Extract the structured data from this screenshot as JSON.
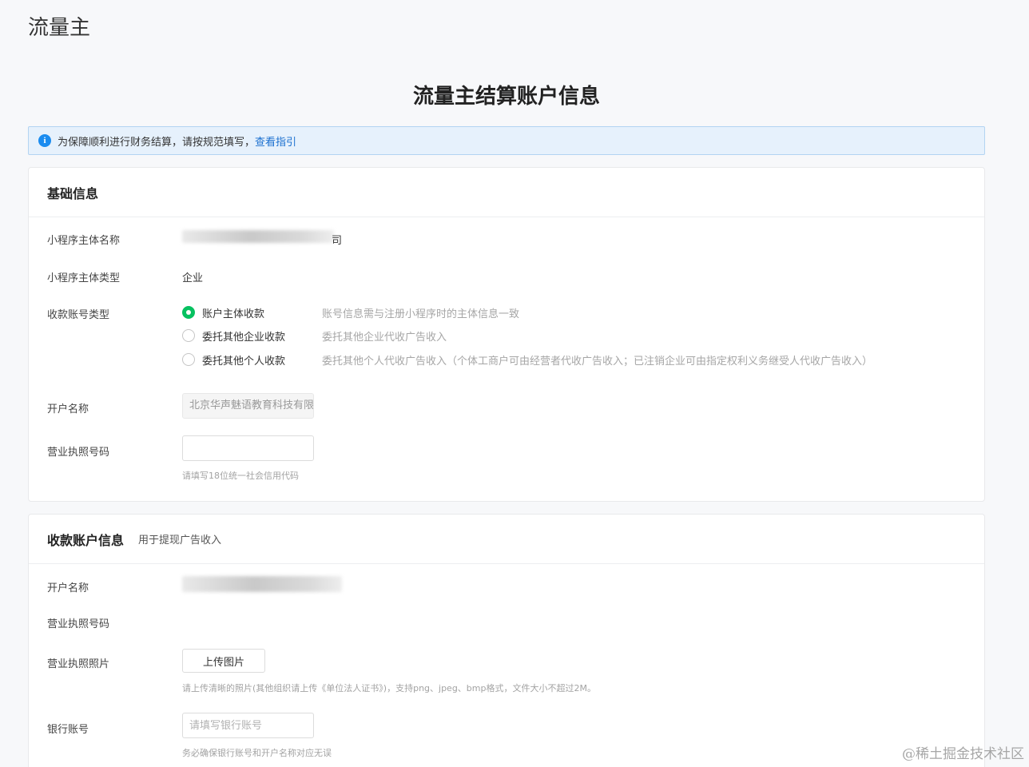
{
  "app": {
    "title": "流量主"
  },
  "page": {
    "title": "流量主结算账户信息"
  },
  "notice": {
    "text": "为保障顺利进行财务结算，请按规范填写，",
    "link": "查看指引"
  },
  "basic": {
    "title": "基础信息",
    "fields": {
      "entity_name_label": "小程序主体名称",
      "entity_name_suffix": "司",
      "entity_type_label": "小程序主体类型",
      "entity_type_value": "企业",
      "account_type_label": "收款账号类型",
      "options": [
        {
          "label": "账户主体收款",
          "hint": "账号信息需与注册小程序时的主体信息一致"
        },
        {
          "label": "委托其他企业收款",
          "hint": "委托其他企业代收广告收入"
        },
        {
          "label": "委托其他个人收款",
          "hint": "委托其他个人代收广告收入（个体工商户可由经营者代收广告收入；已注销企业可由指定权利义务继受人代收广告收入）"
        }
      ],
      "account_name_label": "开户名称",
      "account_name_value": "北京华声魅语教育科技有限",
      "license_label": "营业执照号码",
      "license_value": "",
      "license_help": "请填写18位统一社会信用代码"
    }
  },
  "payee": {
    "title": "收款账户信息",
    "subtitle": "用于提现广告收入",
    "fields": {
      "account_name_label": "开户名称",
      "license_label": "营业执照号码",
      "photo_label": "营业执照照片",
      "upload_label": "上传图片",
      "upload_help": "请上传清晰的照片(其他组织请上传《单位法人证书》)，支持png、jpeg、bmp格式，文件大小不超过2M。",
      "bank_label": "银行账号",
      "bank_placeholder": "请填写银行账号",
      "bank_help": "务必确保银行账号和开户名称对应无误"
    }
  },
  "watermark": "@稀土掘金技术社区"
}
